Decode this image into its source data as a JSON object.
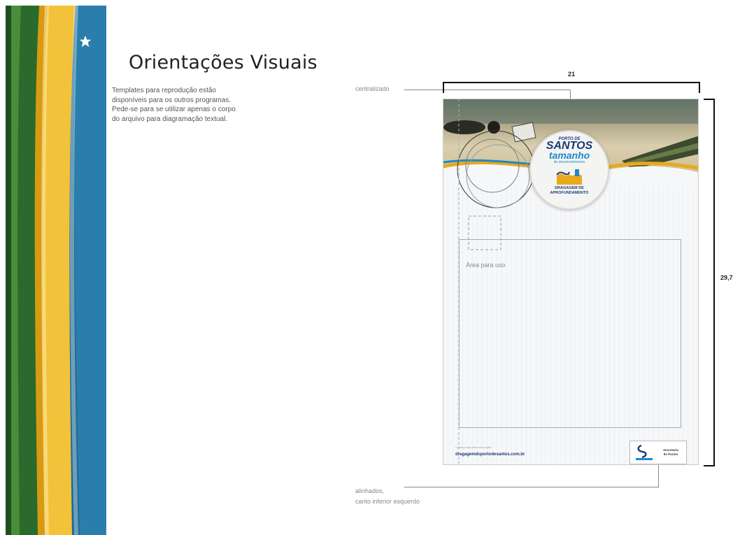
{
  "colors": {
    "green": "#2e6b2f",
    "gold": "#e8b52a",
    "blue": "#1f6a95",
    "navy": "#1b3a78"
  },
  "header": {
    "title": "Orientações Visuais"
  },
  "description": {
    "lines": [
      "Templates para reprodução estão",
      "disponíveis para os outros programas.",
      "Pede-se para se utilizar apenas o corpo",
      "do arquivo para diagramação textual."
    ]
  },
  "annotations": {
    "centered": "centralizado",
    "aligned_line1": "alinhados,",
    "aligned_line2": "canto inferior esquerdo"
  },
  "dimensions": {
    "width": "21",
    "height": "29,7"
  },
  "template": {
    "seal_line1": "PORTO DE",
    "seal_line2": "SANTOS",
    "seal_line3": "tamanho",
    "seal_line4": "do desenvolvimento",
    "seal_line5": "DRAGAGEM DE",
    "seal_line6": "APROFUNDAMENTO",
    "area_label": "Área para uso",
    "footer_small": "Conheça mais sobre este projeto",
    "footer_url": "dragagemdoportodesantos.com.br",
    "logo_label_line1": "Secretaria",
    "logo_label_line2": "de Portos",
    "star_icon": "star-icon",
    "emblem_icon": "emblem-icon"
  }
}
